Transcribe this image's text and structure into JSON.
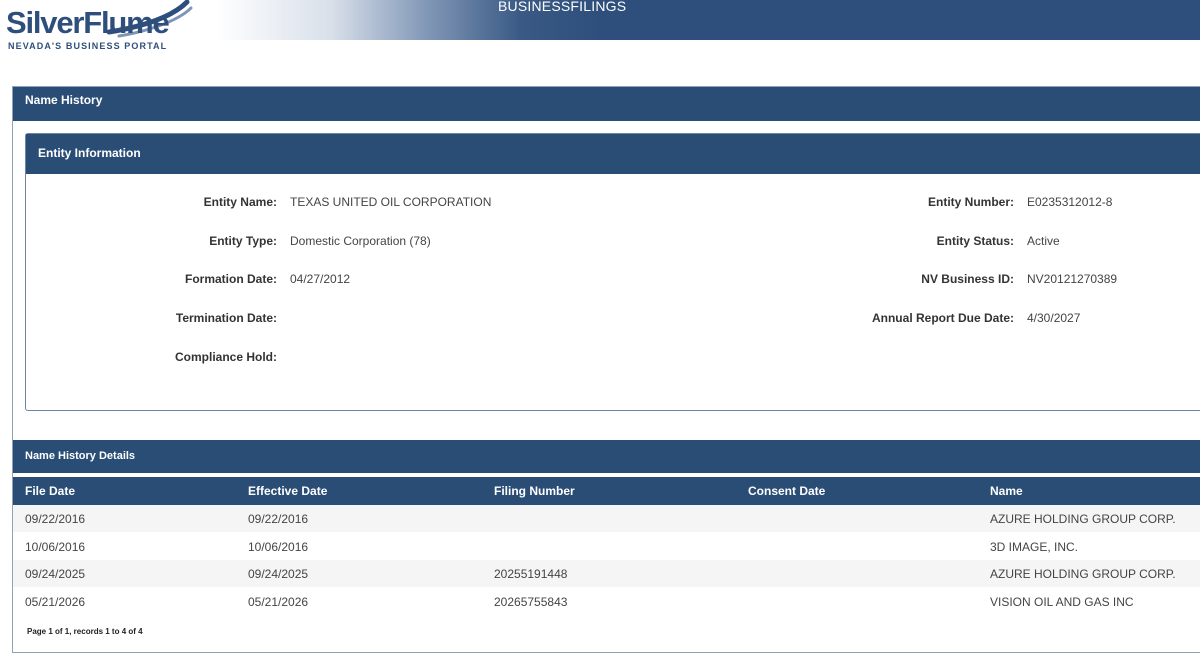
{
  "header": {
    "logo_title": "SilverFlume",
    "logo_subtitle": "NEVADA'S BUSINESS PORTAL",
    "section_title": "BUSINESSFILINGS",
    "brand_color": "#2a4d76"
  },
  "panel": {
    "title": "Name History"
  },
  "entity_info": {
    "title": "Entity Information",
    "left": [
      {
        "label": "Entity Name:",
        "value": "TEXAS UNITED OIL CORPORATION"
      },
      {
        "label": "Entity Type:",
        "value": "Domestic Corporation (78)"
      },
      {
        "label": "Formation Date:",
        "value": "04/27/2012"
      },
      {
        "label": "Termination Date:",
        "value": ""
      },
      {
        "label": "Compliance Hold:",
        "value": ""
      }
    ],
    "right": [
      {
        "label": "Entity Number:",
        "value": "E0235312012-8"
      },
      {
        "label": "Entity Status:",
        "value": "Active"
      },
      {
        "label": "NV Business ID:",
        "value": "NV20121270389"
      },
      {
        "label": "Annual Report Due Date:",
        "value": "4/30/2027"
      }
    ]
  },
  "details": {
    "title": "Name History Details",
    "columns": [
      "File Date",
      "Effective Date",
      "Filing Number",
      "Consent Date",
      "Name"
    ],
    "rows": [
      [
        "09/22/2016",
        "09/22/2016",
        "",
        "",
        "AZURE HOLDING GROUP CORP."
      ],
      [
        "10/06/2016",
        "10/06/2016",
        "",
        "",
        "3D IMAGE, INC."
      ],
      [
        "09/24/2025",
        "09/24/2025",
        "20255191448",
        "",
        "AZURE HOLDING GROUP CORP."
      ],
      [
        "05/21/2026",
        "05/21/2026",
        "20265755843",
        "",
        "VISION OIL AND GAS INC"
      ]
    ],
    "pager": "Page 1 of 1, records 1 to 4 of 4"
  }
}
